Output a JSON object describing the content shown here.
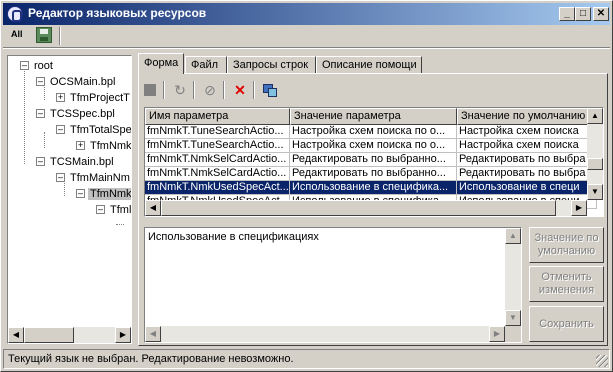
{
  "window": {
    "title": "Редактор языковых ресурсов",
    "minimize": "_",
    "maximize": "□",
    "close": "✕"
  },
  "toolbar": {
    "all_label": "All",
    "save_icon": "save-icon"
  },
  "tree": {
    "nodes": [
      {
        "label": "root",
        "expander": "–"
      },
      {
        "label": "OCSMain.bpl",
        "expander": "–"
      },
      {
        "label": "TfmProjectT",
        "expander": "+"
      },
      {
        "label": "TCSSpec.bpl",
        "expander": "–"
      },
      {
        "label": "TfmTotalSpe",
        "expander": "–"
      },
      {
        "label": "TfmNmk",
        "expander": "+"
      },
      {
        "label": "TCSMain.bpl",
        "expander": "–"
      },
      {
        "label": "TfmMainNm",
        "expander": "–"
      },
      {
        "label": "TfmNmk",
        "expander": "–"
      },
      {
        "label": "Tfml",
        "expander": "–"
      }
    ]
  },
  "tabs": [
    {
      "label": "Форма",
      "active": true
    },
    {
      "label": "Файл",
      "active": false
    },
    {
      "label": "Запросы строк",
      "active": false
    },
    {
      "label": "Описание помощи",
      "active": false
    }
  ],
  "grid": {
    "columns": [
      "Имя параметра",
      "Значение параметра",
      "Значение по умолчанию"
    ],
    "rows": [
      [
        "fmNmkT.TuneSearchActio...",
        "Настройка схем поиска по о...",
        "Настройка схем поиска"
      ],
      [
        "fmNmkT.TuneSearchActio...",
        "Настройка схем поиска по о...",
        "Настройка схем поиска"
      ],
      [
        "fmNmkT.NmkSelCardActio...",
        "Редактировать по выбранно...",
        "Редактировать по выбра"
      ],
      [
        "fmNmkT.NmkSelCardActio...",
        "Редактировать по выбранно...",
        "Редактировать по выбра"
      ],
      [
        "fmNmkT.NmkUsedSpecAct...",
        "Использование в специфика...",
        "Использование в специ"
      ],
      [
        "fmNmkT.NmkUsedSpecAct...",
        "Использование в специфика...",
        "Использование в специ"
      ]
    ],
    "selected_row": 4
  },
  "memo": {
    "text": "Использование в спецификациях"
  },
  "buttons": {
    "default_value": "Значение по умолчанию",
    "undo_changes": "Отменить изменения",
    "save": "Сохранить"
  },
  "status": {
    "text": "Текущий язык не выбран. Редактирование невозможно."
  }
}
